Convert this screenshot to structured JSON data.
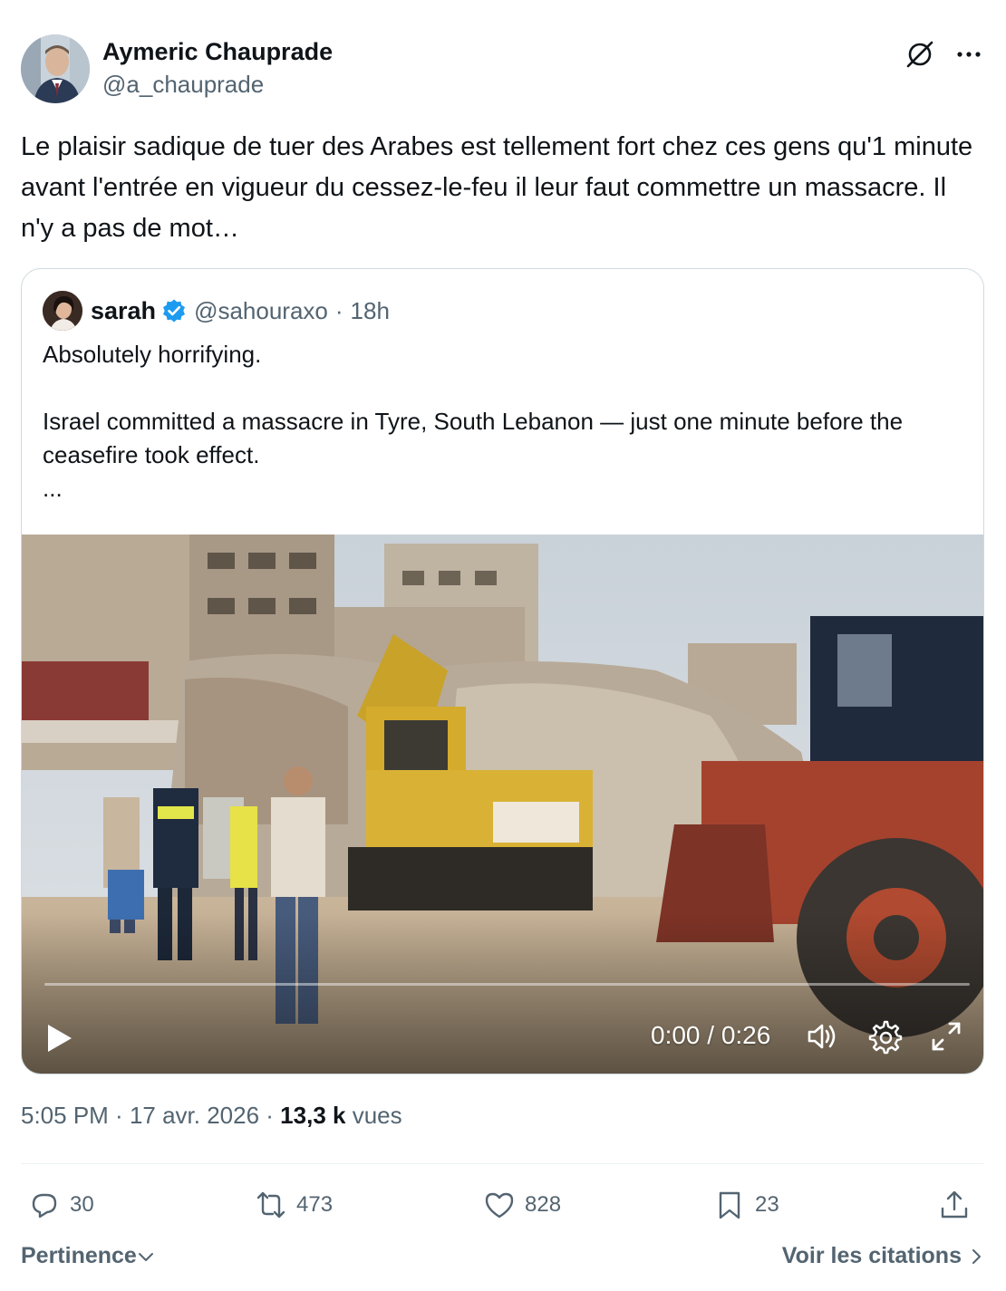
{
  "author": {
    "name": "Aymeric Chauprade",
    "handle": "@a_chauprade"
  },
  "tweet": {
    "text": "Le plaisir sadique de tuer des Arabes est tellement fort chez ces gens qu'1 minute avant l'entrée en vigueur du cessez-le-feu il leur faut commettre un massacre. Il n'y a pas de mot…"
  },
  "quote": {
    "name": "sarah",
    "handle": "@sahouraxo",
    "separator": "·",
    "time": "18h",
    "line1": "Absolutely horrifying.",
    "line2": "Israel committed a massacre in Tyre, South Lebanon — just one minute before the ceasefire took effect.",
    "line3": "..."
  },
  "video": {
    "time": "0:00 / 0:26",
    "progress": 0
  },
  "meta": {
    "time": "5:05 PM",
    "sep1": " · ",
    "date": "17 avr. 2026",
    "sep2": " · ",
    "views_count": "13,3 k",
    "views_label": " vues"
  },
  "actions": {
    "replies": "30",
    "reposts": "473",
    "likes": "828",
    "bookmarks": "23"
  },
  "footer": {
    "sort_label": "Pertinence",
    "quotes_link": "Voir les citations"
  },
  "colors": {
    "text": "#0f1419",
    "secondary": "#536471",
    "border": "#cfd9de",
    "verified": "#1d9bf0"
  },
  "icons": [
    "grok-icon",
    "more-icon",
    "verified-badge-icon",
    "play-icon",
    "volume-icon",
    "settings-icon",
    "fullscreen-icon",
    "reply-icon",
    "repost-icon",
    "like-icon",
    "bookmark-icon",
    "share-icon",
    "chevron-down-icon",
    "chevron-right-icon"
  ]
}
